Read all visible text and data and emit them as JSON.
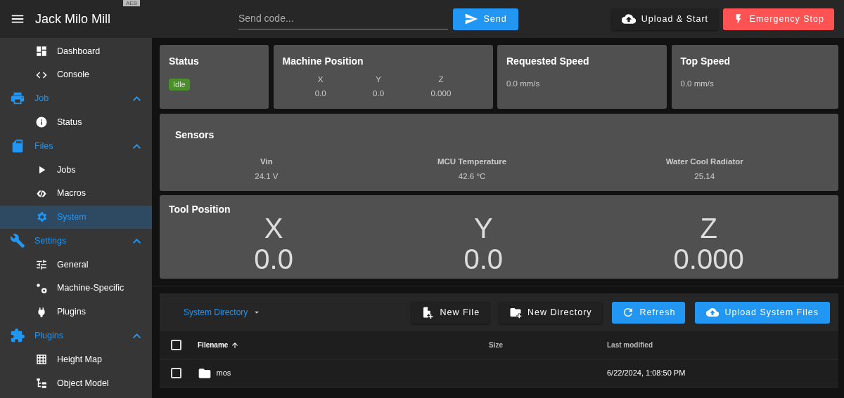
{
  "header": {
    "title": "Jack Milo Mill",
    "tag": "AEB",
    "code_field": {
      "placeholder": "Send code..."
    },
    "send_button": "Send",
    "upload_button": "Upload & Start",
    "stop_button": "Emergency Stop"
  },
  "sidebar": {
    "items": [
      {
        "kind": "item",
        "label": "Dashboard",
        "selected": false
      },
      {
        "kind": "item",
        "label": "Console",
        "selected": false
      },
      {
        "kind": "group",
        "label": "Job",
        "expanded": true,
        "children": [
          {
            "kind": "item",
            "label": "Status",
            "selected": false
          }
        ]
      },
      {
        "kind": "group",
        "label": "Files",
        "expanded": true,
        "children": [
          {
            "kind": "item",
            "label": "Jobs",
            "selected": false
          },
          {
            "kind": "item",
            "label": "Macros",
            "selected": false
          },
          {
            "kind": "item",
            "label": "System",
            "selected": true
          }
        ]
      },
      {
        "kind": "group",
        "label": "Settings",
        "expanded": true,
        "children": [
          {
            "kind": "item",
            "label": "General",
            "selected": false
          },
          {
            "kind": "item",
            "label": "Machine-Specific",
            "selected": false
          },
          {
            "kind": "item",
            "label": "Plugins",
            "selected": false
          }
        ]
      },
      {
        "kind": "group",
        "label": "Plugins",
        "expanded": true,
        "children": [
          {
            "kind": "item",
            "label": "Height Map",
            "selected": false
          },
          {
            "kind": "item",
            "label": "Object Model",
            "selected": false
          }
        ]
      }
    ]
  },
  "status_card": {
    "title": "Status",
    "state": "Idle",
    "color": "#4a8f2c"
  },
  "machine_position": {
    "title": "Machine Position",
    "axes": [
      {
        "axis": "X",
        "value": "0.0"
      },
      {
        "axis": "Y",
        "value": "0.0"
      },
      {
        "axis": "Z",
        "value": "0.000"
      }
    ]
  },
  "requested_speed": {
    "title": "Requested Speed",
    "value": "0.0 mm/s"
  },
  "top_speed": {
    "title": "Top Speed",
    "value": "0.0 mm/s"
  },
  "sensors": {
    "title": "Sensors",
    "items": [
      {
        "name": "Vin",
        "value": "24.1 V"
      },
      {
        "name": "MCU Temperature",
        "value": "42.6 °C"
      },
      {
        "name": "Water Cool Radiator",
        "value": "25.14"
      }
    ]
  },
  "tool_position": {
    "title": "Tool Position",
    "axes": [
      {
        "axis": "X",
        "value": "0.0"
      },
      {
        "axis": "Y",
        "value": "0.0"
      },
      {
        "axis": "Z",
        "value": "0.000"
      }
    ]
  },
  "files": {
    "directory": "System Directory",
    "buttons": [
      {
        "kind": "new-file",
        "label": "New File"
      },
      {
        "kind": "new-directory",
        "label": "New Directory"
      },
      {
        "kind": "refresh",
        "label": "Refresh"
      },
      {
        "kind": "upload",
        "label": "Upload System Files"
      }
    ],
    "all_checked": false,
    "columns": [
      "Filename",
      "Size",
      "Last modified"
    ],
    "rows": [
      {
        "kind": "folder",
        "name": "mos",
        "size": "",
        "modified": "6/22/2024, 1:08:50 PM",
        "checked": false
      }
    ]
  }
}
